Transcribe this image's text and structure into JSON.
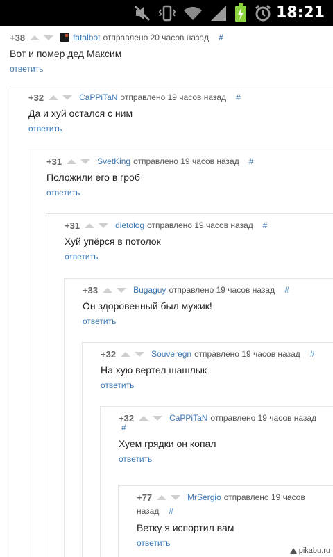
{
  "status_bar": {
    "time": "18:21",
    "icons": [
      "mute-icon",
      "vibrate-icon",
      "wifi-icon",
      "signal-icon",
      "battery-charging-icon",
      "alarm-icon"
    ]
  },
  "colors": {
    "link": "#3a77b4",
    "text": "#222222",
    "meta": "#555555",
    "vote_arrow": "#cfcfcf"
  },
  "comments": [
    {
      "score": "+38",
      "author": "fatalbot",
      "time": "отправлено 20 часов назад",
      "permalink": "#",
      "text": "Вот и помер дед Максим",
      "reply": "ответить"
    },
    {
      "score": "+32",
      "author": "CaPPiTaN",
      "time": "отправлено 19 часов назад",
      "permalink": "#",
      "text": "Да и хуй остался с ним",
      "reply": "ответить"
    },
    {
      "score": "+31",
      "author": "SvetKing",
      "time": "отправлено 19 часов назад",
      "permalink": "#",
      "text": "Положили его в гроб",
      "reply": "ответить"
    },
    {
      "score": "+31",
      "author": "dietolog",
      "time": "отправлено 19 часов назад",
      "permalink": "#",
      "text": "Хуй упёрся в потолок",
      "reply": "ответить"
    },
    {
      "score": "+33",
      "author": "Bugaguy",
      "time": "отправлено 19 часов назад",
      "permalink": "#",
      "text": "Он здоровенный был мужик!",
      "reply": "ответить"
    },
    {
      "score": "+32",
      "author": "Souveregn",
      "time": "отправлено 19 часов назад",
      "permalink": "#",
      "text": "На хую вертел шашлык",
      "reply": "ответить"
    },
    {
      "score": "+32",
      "author": "CaPPiTaN",
      "time": "отправлено 19 часов назад",
      "permalink": "#",
      "text": "Хуем грядки он копал",
      "reply": "ответить"
    },
    {
      "score": "+77",
      "author": "MrSergio",
      "time": "отправлено 19 часов",
      "time_cont": "назад",
      "permalink": "#",
      "text": "Ветку я испортил вам",
      "reply": "ответить"
    }
  ],
  "watermark": {
    "text": "pikabu.ru"
  }
}
